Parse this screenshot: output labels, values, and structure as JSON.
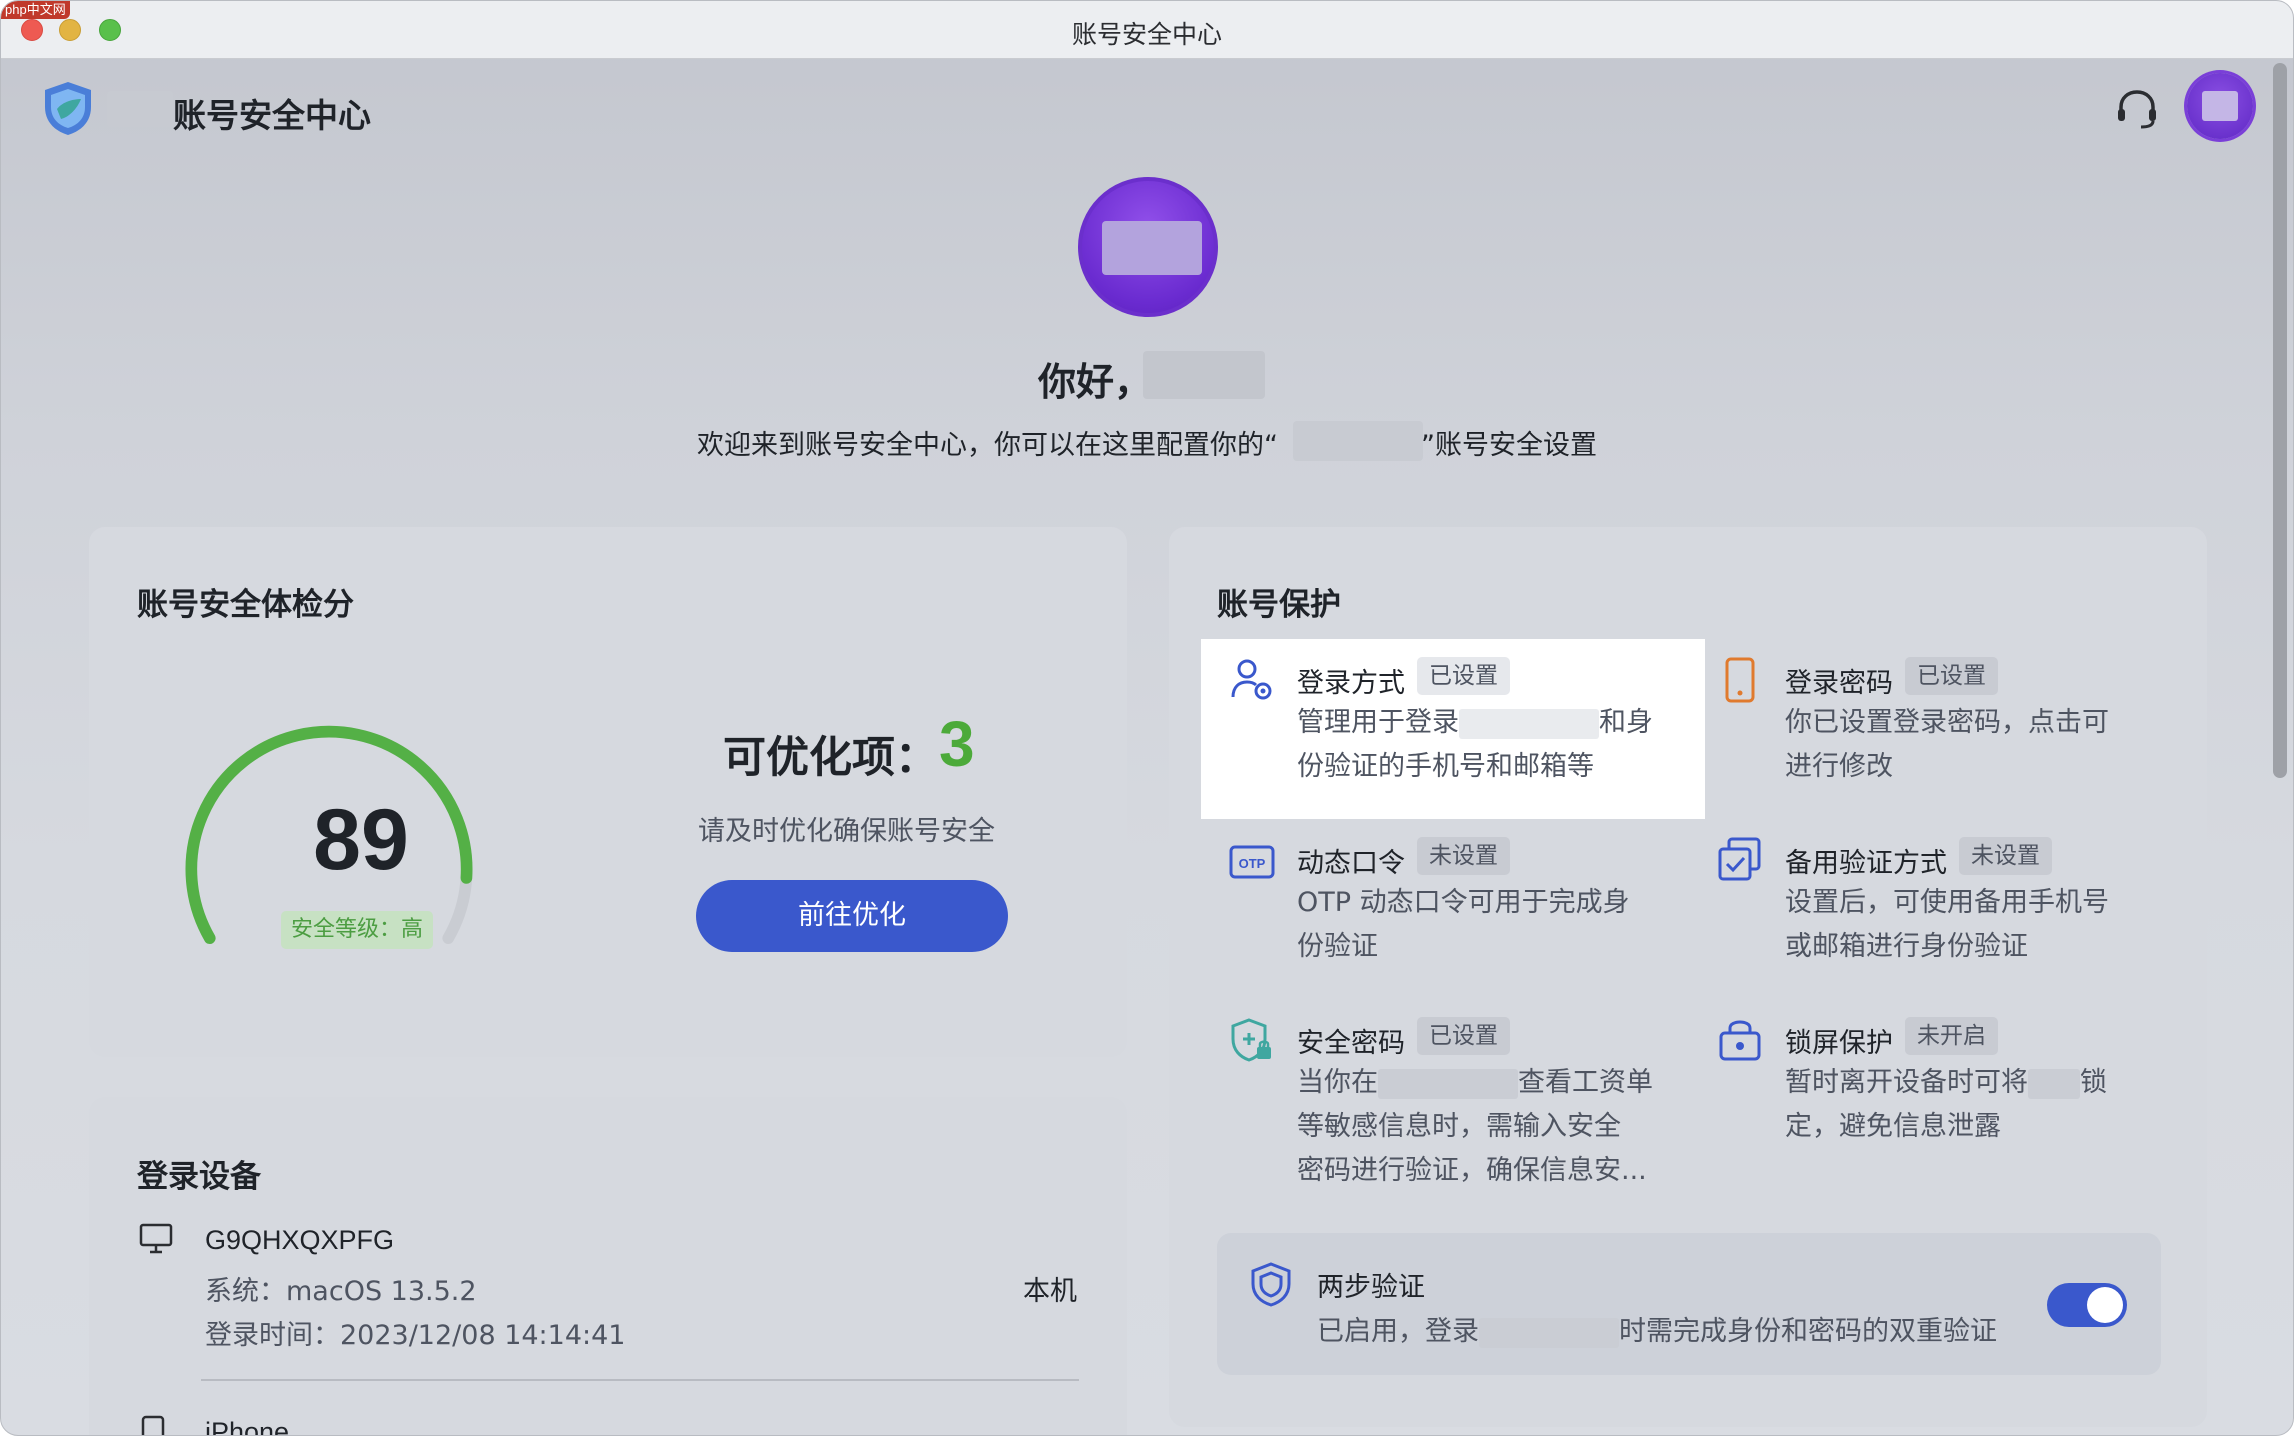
{
  "window": {
    "title": "账号安全中心",
    "watermark": "php中文网"
  },
  "header": {
    "brand_title": "账号安全中心"
  },
  "hero": {
    "greeting": "你好，",
    "welcome_prefix": "欢迎来到账号安全中心，你可以在这里配置你的“",
    "welcome_suffix": "”账号安全设置"
  },
  "score_card": {
    "title": "账号安全体检分",
    "score": "89",
    "score_value": 89,
    "score_max": 100,
    "level": "安全等级：高",
    "optimize_label": "可优化项：",
    "optimize_count": "3",
    "optimize_sub": "请及时优化确保账号安全",
    "optimize_button": "前往优化"
  },
  "devices": {
    "title": "登录设备",
    "items": [
      {
        "name": "G9QHXQXPFG",
        "os": "系统：macOS 13.5.2",
        "login_time": "登录时间：2023/12/08 14:14:41",
        "tag": "本机"
      },
      {
        "name": "iPhone"
      }
    ]
  },
  "protection": {
    "title": "账号保护",
    "items": [
      {
        "icon": "user-gear-icon",
        "label": "登录方式",
        "tag": "已设置",
        "desc_1a": "管理用于登录",
        "desc_1b": "和身",
        "desc_2": "份验证的手机号和邮箱等"
      },
      {
        "icon": "phone-icon",
        "label": "登录密码",
        "tag": "已设置",
        "desc_1": "你已设置登录密码，点击可",
        "desc_2": "进行修改"
      },
      {
        "icon": "otp-icon",
        "label": "动态口令",
        "tag": "未设置",
        "desc_1": "OTP 动态口令可用于完成身",
        "desc_2": "份验证"
      },
      {
        "icon": "backup-verify-icon",
        "label": "备用验证方式",
        "tag": "未设置",
        "desc_1": "设置后，可使用备用手机号",
        "desc_2": "或邮箱进行身份验证"
      },
      {
        "icon": "shield-lock-icon",
        "label": "安全密码",
        "tag": "已设置",
        "desc_1a": "当你在",
        "desc_1b": "查看工资单",
        "desc_2": "等敏感信息时，需输入安全",
        "desc_3": "密码进行验证，确保信息安..."
      },
      {
        "icon": "lock-screen-icon",
        "label": "锁屏保护",
        "tag": "未开启",
        "desc_1a": "暂时离开设备时可将",
        "desc_1b": "锁",
        "desc_2": "定，避免信息泄露"
      }
    ],
    "two_step": {
      "title": "两步验证",
      "desc_a": "已启用，登录",
      "desc_b": "时需完成身份和密码的双重验证",
      "enabled": true
    }
  },
  "colors": {
    "accent": "#3a58cc",
    "success": "#4caa3a",
    "avatar": "#6a2bd0"
  }
}
